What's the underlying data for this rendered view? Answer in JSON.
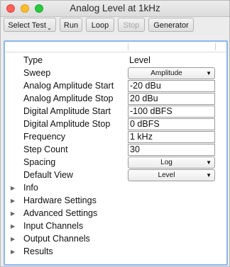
{
  "window": {
    "title": "Analog Level at 1kHz"
  },
  "toolbar": {
    "select_test": "Select Test",
    "run": "Run",
    "loop": "Loop",
    "stop": "Stop",
    "generator": "Generator"
  },
  "settings": {
    "type": {
      "label": "Type",
      "value": "Level"
    },
    "sweep": {
      "label": "Sweep",
      "value": "Amplitude"
    },
    "analog_start": {
      "label": "Analog Amplitude Start",
      "value": "-20 dBu"
    },
    "analog_stop": {
      "label": "Analog Amplitude Stop",
      "value": "20 dBu"
    },
    "digital_start": {
      "label": "Digital Amplitude Start",
      "value": "-100 dBFS"
    },
    "digital_stop": {
      "label": "Digital Amplitude Stop",
      "value": "0 dBFS"
    },
    "frequency": {
      "label": "Frequency",
      "value": "1 kHz"
    },
    "step_count": {
      "label": "Step Count",
      "value": "30"
    },
    "spacing": {
      "label": "Spacing",
      "value": "Log"
    },
    "default_view": {
      "label": "Default View",
      "value": "Level"
    }
  },
  "sections": {
    "info": "Info",
    "hardware": "Hardware Settings",
    "advanced": "Advanced Settings",
    "input": "Input Channels",
    "output": "Output Channels",
    "results": "Results"
  },
  "icons": {
    "dropdown": "chevron-down-icon",
    "disclosure": "disclosure-triangle-icon"
  }
}
